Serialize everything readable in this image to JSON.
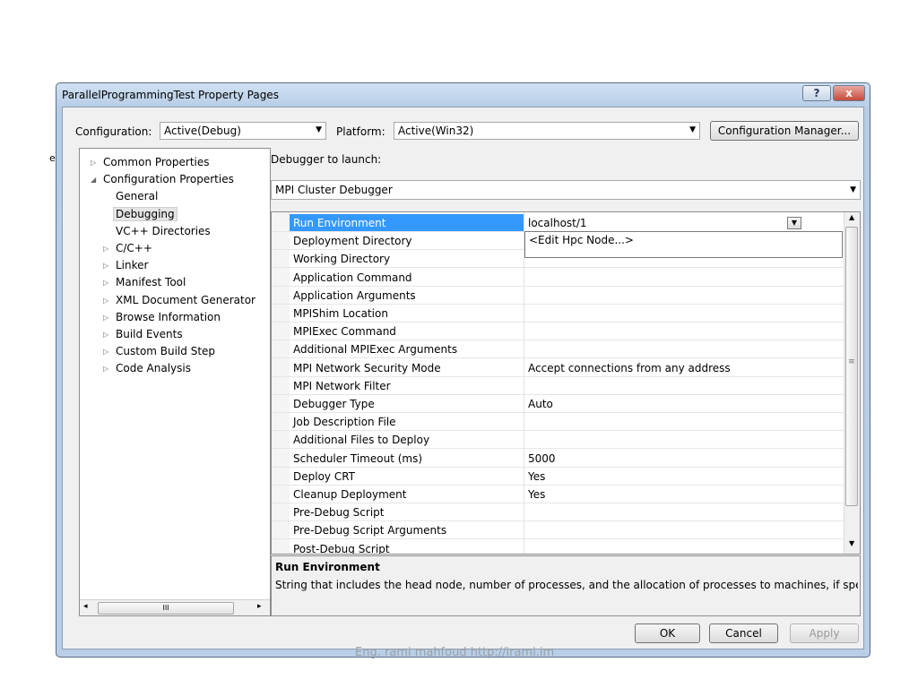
{
  "edge_char": "e",
  "window": {
    "title": "ParallelProgrammingTest Property Pages",
    "help_label": "?",
    "close_label": "x"
  },
  "config": {
    "configuration_label": "Configuration:",
    "configuration_value": "Active(Debug)",
    "platform_label": "Platform:",
    "platform_value": "Active(Win32)",
    "manager_button": "Configuration Manager..."
  },
  "tree": {
    "items": [
      {
        "label": "Common Properties",
        "expander": "▷"
      },
      {
        "label": "Configuration Properties",
        "expander": "◢"
      },
      {
        "label": "General",
        "expander": ""
      },
      {
        "label": "Debugging",
        "expander": ""
      },
      {
        "label": "VC++ Directories",
        "expander": ""
      },
      {
        "label": "C/C++",
        "expander": "▷"
      },
      {
        "label": "Linker",
        "expander": "▷"
      },
      {
        "label": "Manifest Tool",
        "expander": "▷"
      },
      {
        "label": "XML Document Generator",
        "expander": "▷"
      },
      {
        "label": "Browse Information",
        "expander": "▷"
      },
      {
        "label": "Build Events",
        "expander": "▷"
      },
      {
        "label": "Custom Build Step",
        "expander": "▷"
      },
      {
        "label": "Code Analysis",
        "expander": "▷"
      }
    ],
    "selected_index": 3,
    "scroll_left": "◂",
    "scroll_thumb": "III",
    "scroll_right": "▸"
  },
  "debugger": {
    "launch_label": "Debugger to launch:",
    "launch_value": "MPI Cluster Debugger"
  },
  "grid": {
    "rows": [
      {
        "name": "Run Environment",
        "value": "localhost/1"
      },
      {
        "name": "Deployment Directory",
        "value": ""
      },
      {
        "name": "Working Directory",
        "value": ""
      },
      {
        "name": "Application Command",
        "value": ""
      },
      {
        "name": "Application Arguments",
        "value": ""
      },
      {
        "name": "MPIShim Location",
        "value": ""
      },
      {
        "name": "MPIExec Command",
        "value": ""
      },
      {
        "name": "Additional MPIExec Arguments",
        "value": ""
      },
      {
        "name": "MPI Network Security Mode",
        "value": "Accept connections from any address"
      },
      {
        "name": "MPI Network Filter",
        "value": ""
      },
      {
        "name": "Debugger Type",
        "value": "Auto"
      },
      {
        "name": "Job Description File",
        "value": ""
      },
      {
        "name": "Additional Files to Deploy",
        "value": ""
      },
      {
        "name": "Scheduler Timeout (ms)",
        "value": "5000"
      },
      {
        "name": "Deploy CRT",
        "value": "Yes"
      },
      {
        "name": "Cleanup Deployment",
        "value": "Yes"
      },
      {
        "name": "Pre-Debug Script",
        "value": ""
      },
      {
        "name": "Pre-Debug Script Arguments",
        "value": ""
      },
      {
        "name": "Post-Debug Script",
        "value": ""
      }
    ],
    "selected_index": 0,
    "dropdown_option": "<Edit Hpc Node...>",
    "scroll_mid_mark": "≡"
  },
  "description": {
    "title": "Run Environment",
    "text": "String that includes the head node, number of processes, and the allocation of processes to machines, if specified."
  },
  "buttons": {
    "ok": "OK",
    "cancel": "Cancel",
    "apply": "Apply"
  },
  "watermark": "Eng. rami mahfoud http://irami.im",
  "colors": {
    "selection": "#3399ff",
    "title_gradient": "#cfe0f3",
    "close_button": "#c74a3a"
  }
}
